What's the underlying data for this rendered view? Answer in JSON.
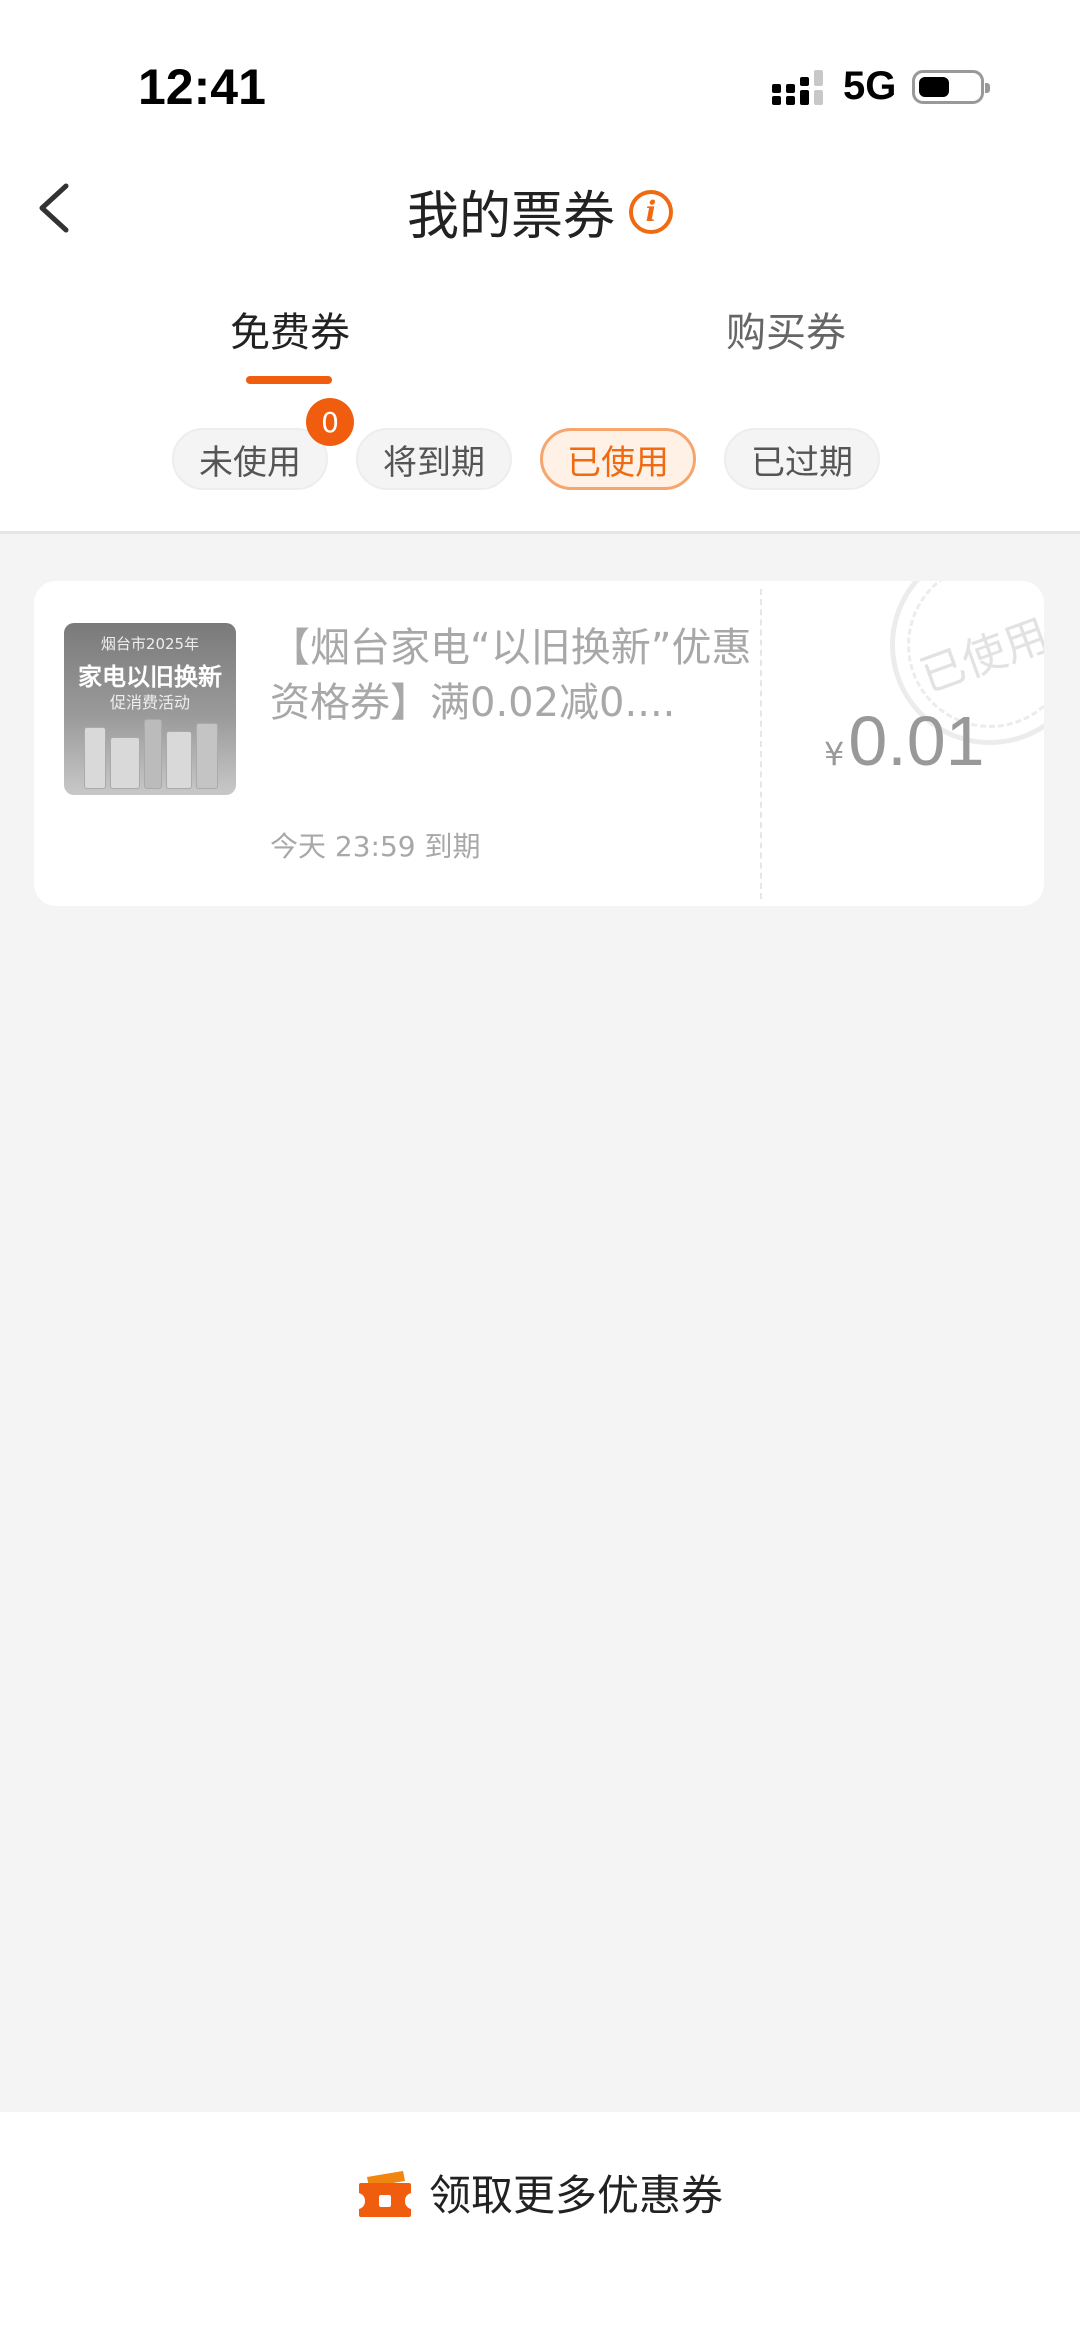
{
  "status_bar": {
    "time": "12:41",
    "network": "5G"
  },
  "header": {
    "title": "我的票券"
  },
  "tabs": [
    {
      "label": "免费券",
      "active": true
    },
    {
      "label": "购买券",
      "active": false
    }
  ],
  "filters": [
    {
      "label": "未使用",
      "badge": "0"
    },
    {
      "label": "将到期"
    },
    {
      "label": "已使用",
      "active": true
    },
    {
      "label": "已过期"
    }
  ],
  "coupons": [
    {
      "title": "【烟台家电“以旧换新”优惠资格券】满0.02减0....",
      "expiry": "今天 23:59 到期",
      "currency": "¥",
      "amount": "0.01",
      "stamp": "已使用",
      "thumb": {
        "line1": "烟台市2025年",
        "line2": "家电以旧换新",
        "line3": "促消费活动"
      }
    }
  ],
  "footer": {
    "label": "领取更多优惠券"
  },
  "colors": {
    "accent": "#f05d0f",
    "background": "#f4f4f4"
  }
}
